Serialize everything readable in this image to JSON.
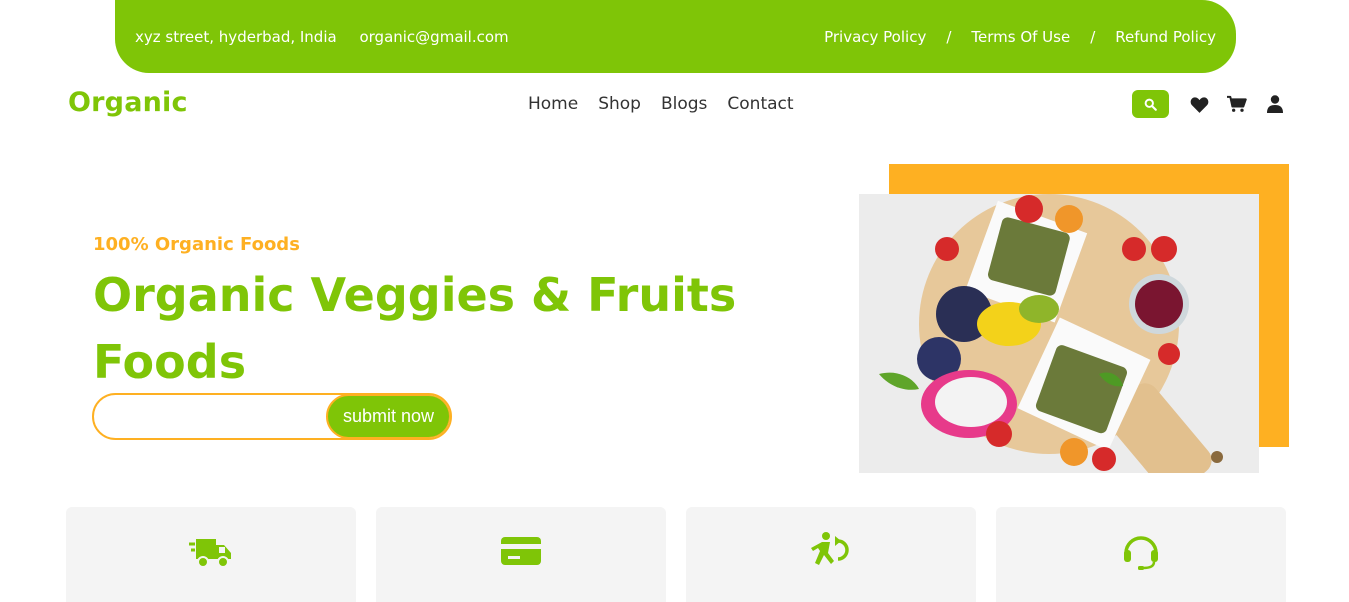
{
  "colors": {
    "green": "#7fc507",
    "orange": "#feb022"
  },
  "topbar": {
    "address": "xyz street, hyderbad, India",
    "email": "organic@gmail.com",
    "links": [
      "Privacy Policy",
      "Terms Of Use",
      "Refund Policy"
    ],
    "separator": "/"
  },
  "nav": {
    "logo": "Organic",
    "menu": [
      "Home",
      "Shop",
      "Blogs",
      "Contact"
    ],
    "icons": [
      "search-icon",
      "heart-icon",
      "cart-icon",
      "user-icon"
    ]
  },
  "hero": {
    "tagline": "100% Organic Foods",
    "title": "Organic Veggies & Fruits Foods",
    "input_value": "",
    "submit_label": "submit now",
    "image": "fruit-platter-photo"
  },
  "features": [
    {
      "icon": "truck-icon"
    },
    {
      "icon": "credit-card-icon"
    },
    {
      "icon": "return-walk-icon"
    },
    {
      "icon": "headset-icon"
    }
  ]
}
